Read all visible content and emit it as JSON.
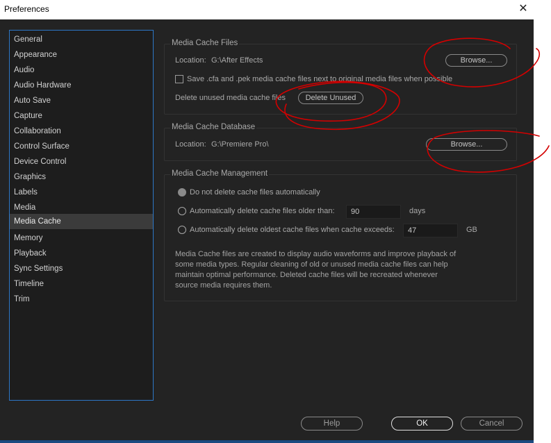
{
  "window": {
    "title": "Preferences",
    "close_glyph": "✕",
    "close_icon": "close-icon"
  },
  "sidebar": {
    "selected_index": 13,
    "items": [
      {
        "label": "General"
      },
      {
        "label": "Appearance"
      },
      {
        "label": "Audio"
      },
      {
        "label": "Audio Hardware"
      },
      {
        "label": "Auto Save"
      },
      {
        "label": "Capture"
      },
      {
        "label": "Collaboration"
      },
      {
        "label": "Control Surface"
      },
      {
        "label": "Device Control"
      },
      {
        "label": "Graphics"
      },
      {
        "label": "Labels"
      },
      {
        "label": "Media"
      },
      {
        "label": "Media Cache"
      },
      {
        "label": "Memory"
      },
      {
        "label": "Playback"
      },
      {
        "label": "Sync Settings"
      },
      {
        "label": "Timeline"
      },
      {
        "label": "Trim"
      }
    ]
  },
  "media_cache_files": {
    "legend": "Media Cache Files",
    "location_label": "Location:",
    "location_value": "G:\\After Effects",
    "browse_label": "Browse...",
    "save_checkbox_label": "Save .cfa and .pek media cache files next to original media files when possible",
    "save_checked": false,
    "delete_label": "Delete unused media cache files",
    "delete_button": "Delete Unused"
  },
  "media_cache_database": {
    "legend": "Media Cache Database",
    "location_label": "Location:",
    "location_value": "G:\\Premiere Pro\\",
    "browse_label": "Browse..."
  },
  "media_cache_management": {
    "legend": "Media Cache Management",
    "options": [
      {
        "label": "Do not delete cache files automatically",
        "selected": true
      },
      {
        "label": "Automatically delete cache files older than:",
        "value": "90",
        "unit": "days"
      },
      {
        "label": "Automatically delete oldest cache files when cache exceeds:",
        "value": "47",
        "unit": "GB"
      }
    ],
    "note": "Media Cache files are created to display audio waveforms and improve playback of\nsome media types.  Regular cleaning of old or unused media cache files can help\nmaintain optimal performance. Deleted cache files will be recreated whenever\nsource media requires them."
  },
  "footer": {
    "help": "Help",
    "ok": "OK",
    "cancel": "Cancel"
  },
  "colors": {
    "dialog_bg": "#232323",
    "sidebar_border": "#2d77c7",
    "annotation": "#d40000"
  }
}
